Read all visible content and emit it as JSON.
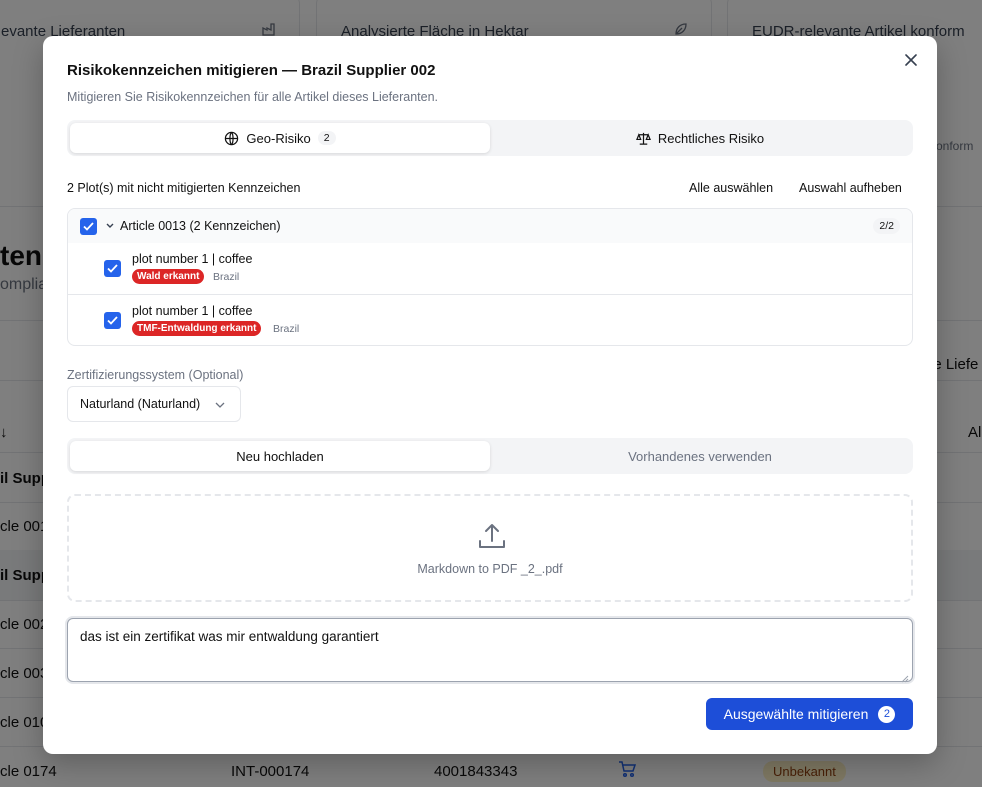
{
  "background": {
    "cards": [
      {
        "title": "evante Lieferanten"
      },
      {
        "title": "Analysierte Fläche in Hektar"
      },
      {
        "title": "EUDR-relevante Artikel konform"
      }
    ],
    "card3_sub": "onform",
    "heading": "ten a",
    "subheading": "omplia",
    "col_right": "le Liefe",
    "sort_arrow": "↓",
    "col_right2": "Al",
    "rows": [
      {
        "label": "il Supp"
      },
      {
        "label": "cle 001"
      },
      {
        "label": "il Supp"
      },
      {
        "label": "cle 002"
      },
      {
        "label": "cle 003"
      },
      {
        "label": "cle 010"
      },
      {
        "label": "cle 0174"
      }
    ],
    "last_row": {
      "int_id": "INT-000174",
      "code": "4001843343",
      "status": "Unbekannt"
    }
  },
  "modal": {
    "title": "Risikokennzeichen mitigieren — Brazil Supplier 002",
    "description": "Mitigieren Sie Risikokennzeichen für alle Artikel dieses Lieferanten.",
    "risk_tabs": [
      {
        "label": "Geo-Risiko",
        "count": "2"
      },
      {
        "label": "Rechtliches Risiko"
      }
    ],
    "plots_summary": "2 Plot(s) mit nicht mitigierten Kennzeichen",
    "select_all": "Alle auswählen",
    "deselect": "Auswahl aufheben",
    "group": {
      "label": "Article 0013 (2 Kennzeichen)",
      "count": "2/2",
      "plots": [
        {
          "name": "plot number 1 | coffee",
          "flag": "Wald erkannt",
          "country": "Brazil"
        },
        {
          "name": "plot number 1 | coffee",
          "flag": "TMF-Entwaldung erkannt",
          "country": "Brazil"
        }
      ]
    },
    "cert_label": "Zertifizierungssystem (Optional)",
    "cert_value": "Naturland (Naturland)",
    "upload_tabs": [
      {
        "label": "Neu hochladen"
      },
      {
        "label": "Vorhandenes verwenden"
      }
    ],
    "file_name": "Markdown to PDF _2_.pdf",
    "note_text": "das ist ein zertifikat was mir entwaldung garantiert",
    "submit_label": "Ausgewählte mitigieren",
    "submit_count": "2"
  }
}
